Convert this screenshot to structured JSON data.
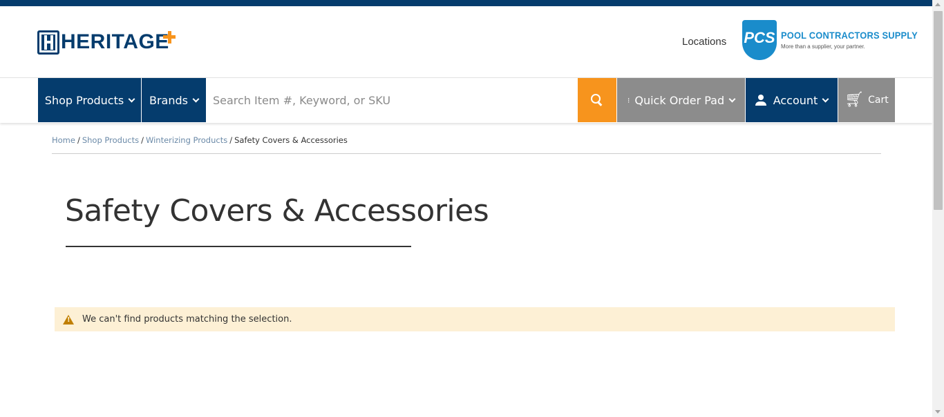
{
  "header": {
    "logo_text": "HERITAGE",
    "locations_label": "Locations",
    "partner": {
      "badge": "PCS",
      "name": "POOL CONTRACTORS SUPPLY",
      "tagline": "More than a supplier, your partner."
    }
  },
  "nav": {
    "shop_products": "Shop Products",
    "brands": "Brands",
    "search_placeholder": "Search Item #, Keyword, or SKU",
    "quick_order": "Quick Order Pad",
    "account": "Account",
    "cart": "Cart"
  },
  "breadcrumb": {
    "items": [
      "Home",
      "Shop Products",
      "Winterizing Products"
    ],
    "current": "Safety Covers & Accessories",
    "separator": "/"
  },
  "page": {
    "title": "Safety Covers & Accessories",
    "notice": "We can't find products matching the selection."
  },
  "colors": {
    "brand_navy": "#053c6d",
    "accent_orange": "#f7941d",
    "partner_blue": "#1a8ccb",
    "notice_bg": "#fdf0d5"
  }
}
